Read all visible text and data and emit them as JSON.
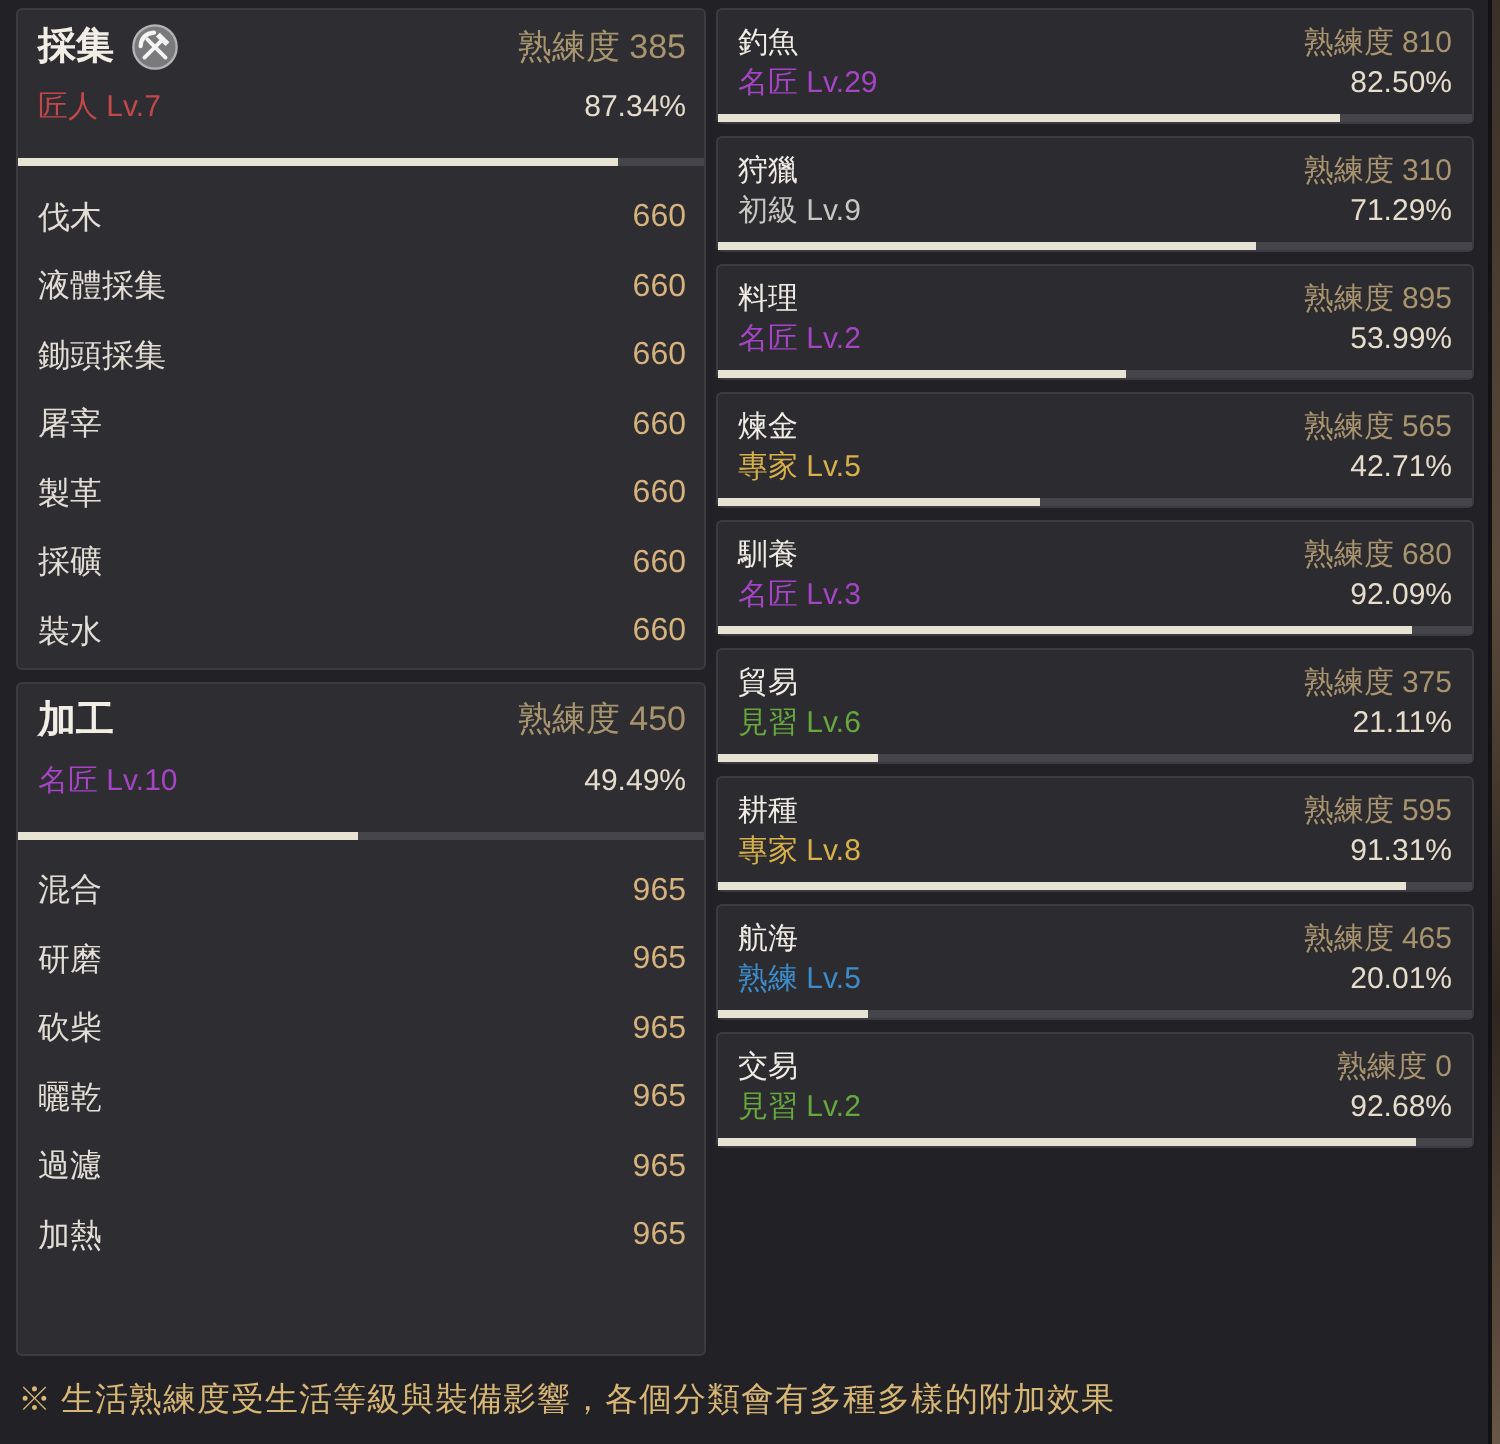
{
  "panels": [
    {
      "title": "採集",
      "icon": true,
      "proficiency": "熟練度 385",
      "rank": "匠人 Lv.7",
      "color": "#c4484a",
      "percent": "87.34%",
      "level": 0.8734,
      "items": [
        {
          "name": "伐木",
          "value": "660"
        },
        {
          "name": "液體採集",
          "value": "660"
        },
        {
          "name": "鋤頭採集",
          "value": "660"
        },
        {
          "name": "屠宰",
          "value": "660"
        },
        {
          "name": "製革",
          "value": "660"
        },
        {
          "name": "採礦",
          "value": "660"
        },
        {
          "name": "裝水",
          "value": "660"
        }
      ]
    },
    {
      "title": "加工",
      "icon": false,
      "proficiency": "熟練度 450",
      "rank": "名匠 Lv.10",
      "color": "#a544c4",
      "percent": "49.49%",
      "level": 0.4949,
      "items": [
        {
          "name": "混合",
          "value": "965"
        },
        {
          "name": "研磨",
          "value": "965"
        },
        {
          "name": "砍柴",
          "value": "965"
        },
        {
          "name": "曬乾",
          "value": "965"
        },
        {
          "name": "過濾",
          "value": "965"
        },
        {
          "name": "加熱",
          "value": "965"
        }
      ]
    }
  ],
  "skills": [
    {
      "name": "釣魚",
      "proficiency": "熟練度 810",
      "rank": "名匠 Lv.29",
      "color": "#a544c4",
      "percent": "82.50%",
      "level": 0.825
    },
    {
      "name": "狩獵",
      "proficiency": "熟練度 310",
      "rank": "初級 Lv.9",
      "color": "#c8c6c0",
      "percent": "71.29%",
      "level": 0.7129
    },
    {
      "name": "料理",
      "proficiency": "熟練度 895",
      "rank": "名匠 Lv.2",
      "color": "#a544c4",
      "percent": "53.99%",
      "level": 0.5399
    },
    {
      "name": "煉金",
      "proficiency": "熟練度 565",
      "rank": "專家 Lv.5",
      "color": "#d8b04a",
      "percent": "42.71%",
      "level": 0.4271
    },
    {
      "name": "馴養",
      "proficiency": "熟練度 680",
      "rank": "名匠 Lv.3",
      "color": "#a544c4",
      "percent": "92.09%",
      "level": 0.9209
    },
    {
      "name": "貿易",
      "proficiency": "熟練度 375",
      "rank": "見習 Lv.6",
      "color": "#66a83e",
      "percent": "21.11%",
      "level": 0.2111
    },
    {
      "name": "耕種",
      "proficiency": "熟練度 595",
      "rank": "專家 Lv.8",
      "color": "#d8b04a",
      "percent": "91.31%",
      "level": 0.9131
    },
    {
      "name": "航海",
      "proficiency": "熟練度 465",
      "rank": "熟練 Lv.5",
      "color": "#3c8ccc",
      "percent": "20.01%",
      "level": 0.2001
    },
    {
      "name": "交易",
      "proficiency": "熟練度 0",
      "rank": "見習 Lv.2",
      "color": "#66a83e",
      "percent": "92.68%",
      "level": 0.9268
    }
  ],
  "footnote": "※ 生活熟練度受生活等級與裝備影響，各個分類會有多種多樣的附加效果"
}
